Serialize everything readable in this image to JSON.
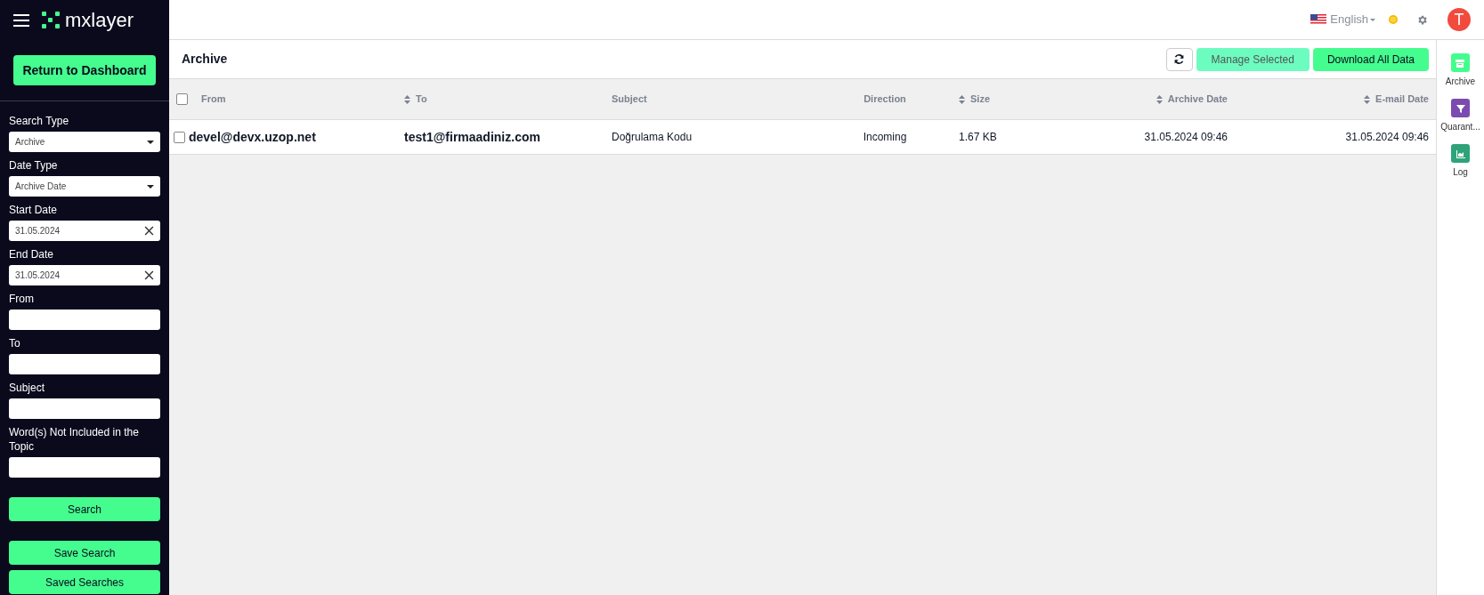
{
  "brand": {
    "name": "mxlayer"
  },
  "sidebar": {
    "return_button": "Return to Dashboard",
    "fields": [
      {
        "kind": "select",
        "label": "Search Type",
        "value": "Archive"
      },
      {
        "kind": "select",
        "label": "Date Type",
        "value": "Archive Date"
      },
      {
        "kind": "date",
        "label": "Start Date",
        "value": "31.05.2024"
      },
      {
        "kind": "date",
        "label": "End Date",
        "value": "31.05.2024"
      },
      {
        "kind": "text",
        "label": "From"
      },
      {
        "kind": "text",
        "label": "To"
      },
      {
        "kind": "text",
        "label": "Subject"
      },
      {
        "kind": "text",
        "label": "Word(s) Not Included in the Topic"
      }
    ],
    "search_button": "Search",
    "buttons": [
      "Save Search",
      "Saved Searches"
    ]
  },
  "topbar": {
    "language": "English",
    "avatar": "T"
  },
  "panel": {
    "title": "Archive",
    "buttons": [
      {
        "label": "Manage Selected",
        "disabled": true
      },
      {
        "label": "Download All Data",
        "disabled": false
      }
    ]
  },
  "table": {
    "select_all": {
      "checked": false
    },
    "columns": [
      {
        "label": "From",
        "sortable": false
      },
      {
        "label": "To",
        "sortable": true
      },
      {
        "label": "Subject",
        "sortable": false
      },
      {
        "label": "Direction",
        "sortable": false
      },
      {
        "label": "Size",
        "sortable": true
      },
      {
        "label": "Archive Date",
        "sortable": true
      },
      {
        "label": "E-mail Date",
        "sortable": true
      }
    ],
    "rows": [
      {
        "checked": false,
        "cells": [
          "devel@devx.uzop.net",
          "test1@firmaadiniz.com",
          "Doğrulama Kodu",
          "Incoming",
          "1.67 KB",
          "31.05.2024 09:46",
          "31.05.2024 09:46"
        ]
      }
    ]
  },
  "rail": [
    {
      "kind": "archive",
      "label": "Archive",
      "color": "#44fd8e"
    },
    {
      "kind": "quarantine",
      "label": "Quarant...",
      "color": "#7b4bb0"
    },
    {
      "kind": "log",
      "label": "Log",
      "color": "#2ea37a"
    }
  ]
}
